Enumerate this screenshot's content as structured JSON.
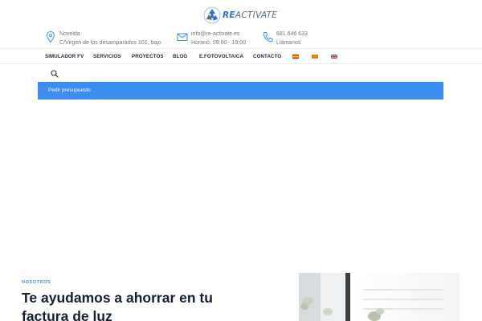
{
  "brand": {
    "logo_prefix": "RE",
    "logo_suffix": "ACTIVATE",
    "colors": {
      "blue": "#2f6fd0",
      "grey": "#5a6b80"
    }
  },
  "contact": {
    "location": {
      "icon": "map-pin-icon",
      "line1": "Novelda",
      "line2": "C/Virgen de los desamparados 101, bajo"
    },
    "email": {
      "icon": "envelope-icon",
      "line1": "info@re-activate.es",
      "line2": "Horario: 09:00 - 19:00"
    },
    "phone": {
      "icon": "phone-icon",
      "line1": "681 646 633",
      "line2": "Llámanos"
    }
  },
  "nav": {
    "items": [
      "SIMULADOR FV",
      "SERVICIOS",
      "PROYECTOS",
      "BLOG",
      "E.FOTOVOLTAICA",
      "CONTACTO"
    ],
    "flags": [
      "spanish-flag-icon",
      "catalan-flag-icon",
      "uk-flag-icon"
    ]
  },
  "search": {
    "icon": "search-icon"
  },
  "quote_bar": {
    "label": "Pedir presupuesto",
    "color": "#3b8eef"
  },
  "about": {
    "eyebrow": "NOSOTROS",
    "headline": "Te ayudamos a ahorrar en tu factura de luz"
  }
}
